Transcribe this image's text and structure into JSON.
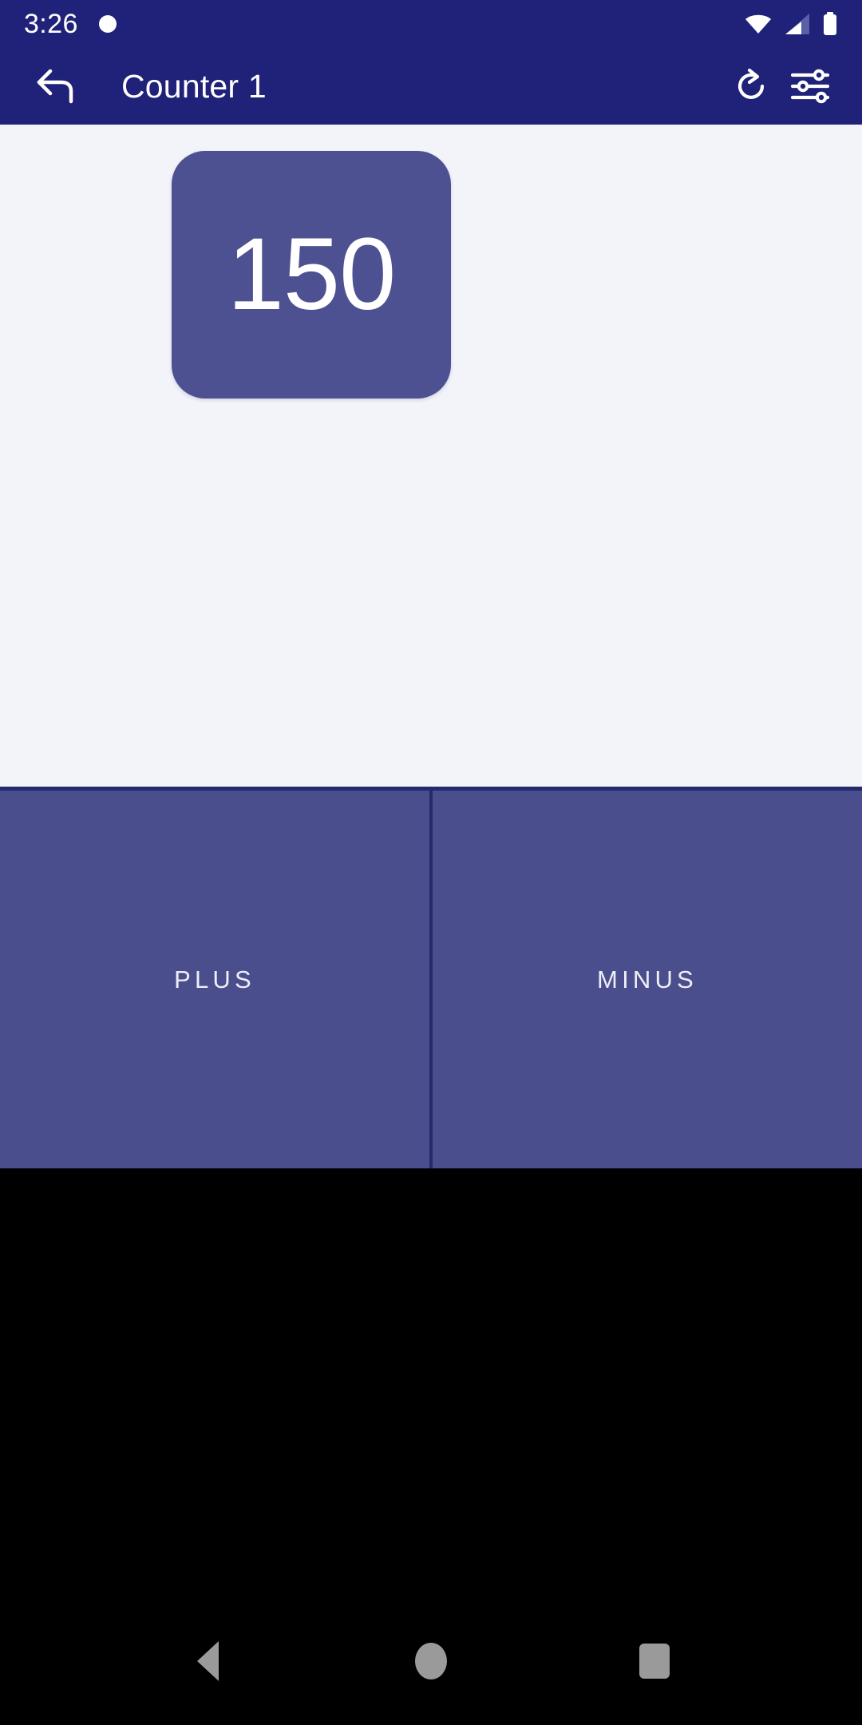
{
  "status_bar": {
    "time": "3:26",
    "notification_dot": "notification-dot",
    "icons": [
      "wifi-icon",
      "cell-signal-icon",
      "battery-icon"
    ],
    "background_color": "#1F2278"
  },
  "app_bar": {
    "back_label": "back-arrow-icon",
    "title": "Counter 1",
    "refresh_label": "refresh-icon",
    "settings_label": "tune-sliders-icon",
    "background_color": "#1F2278",
    "text_color": "#FFFFFF"
  },
  "main": {
    "background_color": "#F3F4FA",
    "counter": {
      "value": "150",
      "card_color": "#4E5191",
      "text_color": "#FFFFFF"
    }
  },
  "actions": {
    "plus_label": "PLUS",
    "minus_label": "MINUS",
    "button_color": "#4B4E8C",
    "divider_color": "#252A6E",
    "label_color": "#EDEEF6"
  },
  "nav_bar": {
    "back": "triangle-back-icon",
    "home": "circle-home-icon",
    "recents": "square-recents-icon",
    "background_color": "#000000",
    "icon_color": "#9A9A9A"
  }
}
